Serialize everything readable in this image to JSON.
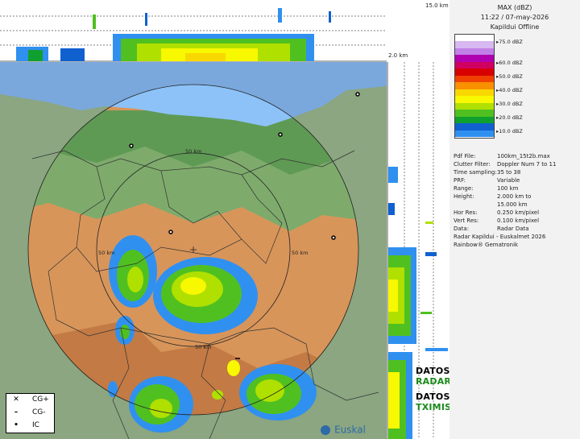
{
  "top_strip": {
    "height_label": "15.0 km",
    "base_label": "2.0 km"
  },
  "panel": {
    "title": "MAX (dBZ)",
    "datetime": "11:22 / 07-may-2026",
    "station": "Kapildui Offline",
    "scale": [
      {
        "label": "75.0 dBZ",
        "color": "#d8b8f0"
      },
      {
        "label": "",
        "color": "#c080e8"
      },
      {
        "label": "",
        "color": "#b000b0"
      },
      {
        "label": "60.0 dBZ",
        "color": "#d00060"
      },
      {
        "label": "",
        "color": "#d80000"
      },
      {
        "label": "50.0 dBZ",
        "color": "#f04000"
      },
      {
        "label": "",
        "color": "#f89000"
      },
      {
        "label": "40.0 dBZ",
        "color": "#f8d800"
      },
      {
        "label": "",
        "color": "#f8f800"
      },
      {
        "label": "30.0 dBZ",
        "color": "#b0e000"
      },
      {
        "label": "",
        "color": "#50c020"
      },
      {
        "label": "20.0 dBZ",
        "color": "#10a030"
      },
      {
        "label": "",
        "color": "#1060d0"
      },
      {
        "label": "10.0 dBZ",
        "color": "#3090f0"
      }
    ],
    "info": [
      {
        "key": "Pdf File:",
        "value": "100km_15t2b.max"
      },
      {
        "key": "Clutter Filter:",
        "value": "Doppler Num 7 to 11"
      },
      {
        "key": "Time sampling:",
        "value": "35 to 38"
      },
      {
        "key": "PRF:",
        "value": "Variable"
      },
      {
        "key": "Range:",
        "value": "100 km"
      },
      {
        "key": "Height:",
        "value": "2.000 km to"
      },
      {
        "key": "",
        "value": "15.000 km"
      },
      {
        "key": "Hor Res:",
        "value": "0.250 km/pixel"
      },
      {
        "key": "Vert Res:",
        "value": "0.100 km/pixel"
      },
      {
        "key": "Data:",
        "value": "Radar Data"
      }
    ],
    "credit1": "Radar Kapildui - Euskalmet 2026",
    "credit2": "Rainbow® Gematronik"
  },
  "map": {
    "range_labels": [
      "50 km",
      "50 km",
      "50 km",
      "50 km"
    ],
    "logo_text": "Euskal"
  },
  "overlay": {
    "radar_es": "DATOS DE RADAR",
    "radar_eu": "RADARREKO DATUAK",
    "rayos_es": "DATOS DE RAYOS",
    "rayos_eu": "TXIMISTEI BURUZKO DATUAK",
    "colors": {
      "es": "#000000",
      "eu": "#1a8a1a"
    }
  },
  "lightning_legend": [
    {
      "symbol": "✕",
      "label": "CG+"
    },
    {
      "symbol": "–",
      "label": "CG-"
    },
    {
      "symbol": "•",
      "label": "IC"
    }
  ]
}
